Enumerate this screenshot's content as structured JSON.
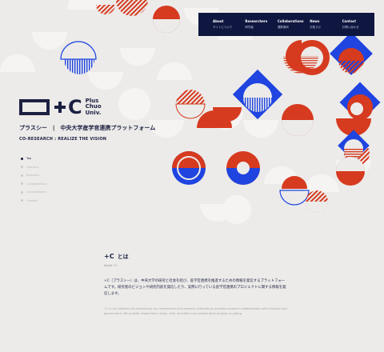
{
  "colors": {
    "navy": "#1b2042",
    "red": "#d63a1f",
    "blue": "#1f44e0",
    "background": "#ecebe9"
  },
  "nav": [
    {
      "en": "About",
      "ja": "サイトについて"
    },
    {
      "en": "Researchers",
      "ja": "研究者"
    },
    {
      "en": "Collaborations",
      "ja": "連携事例"
    },
    {
      "en": "News",
      "ja": "お知らせ"
    },
    {
      "en": "Contact",
      "ja": "お問い合わせ"
    }
  ],
  "logo": {
    "lines": [
      "Plus",
      "Chuo",
      "Univ."
    ],
    "mark": "C"
  },
  "hero": {
    "tagline_ja": "プラスシー　|　中央大学産学官連携プラットフォーム",
    "tagline_en": "CO-RESEARCH : REALIZE THE VISION"
  },
  "side_nav": [
    "Top",
    "Features",
    "Research",
    "Collaborations",
    "Consultations",
    "Contact"
  ],
  "about": {
    "title_mark": "+C",
    "title_text": "とは",
    "subtitle": "About +C",
    "body_ja": "+C（プラスシー）は、中央大学の研究と社会を結び、産学官連携を推進するための情報を発信するプラットフォームです。研究者のビジョンや研究内容を発信したり、実際に行っている産学官連携のプロジェクトに関する情報を発信します。",
    "body_en": "+C is the platform for introducing our researchers and research activities to promote research collaborations with industry and government. We provide researchers' vision, their activities and collaborative projects on going."
  }
}
